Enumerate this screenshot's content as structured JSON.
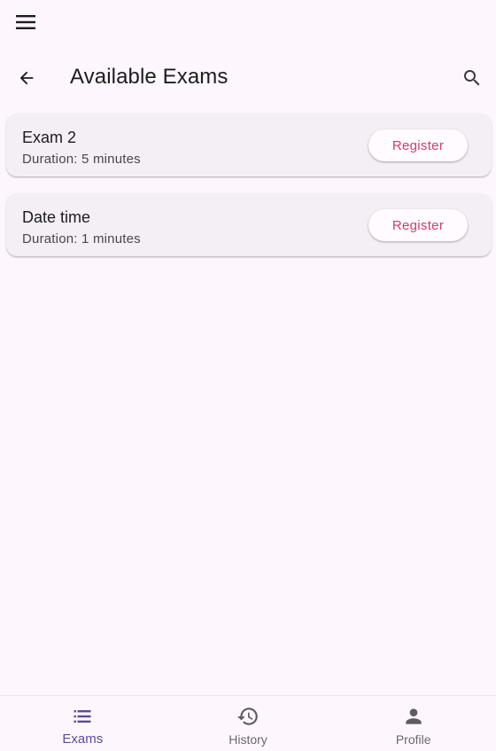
{
  "header": {
    "menu_icon": "hamburger-menu-icon",
    "back_icon": "arrow-back-icon",
    "title": "Available Exams",
    "search_icon": "search-icon"
  },
  "exams": [
    {
      "name": "Exam 2",
      "duration": "Duration: 5 minutes",
      "action_label": "Register"
    },
    {
      "name": "Date time",
      "duration": "Duration: 1 minutes",
      "action_label": "Register"
    }
  ],
  "bottom_nav": {
    "items": [
      {
        "label": "Exams",
        "icon": "list-icon",
        "active": true
      },
      {
        "label": "History",
        "icon": "history-icon",
        "active": false
      },
      {
        "label": "Profile",
        "icon": "person-icon",
        "active": false
      }
    ]
  },
  "colors": {
    "background": "#fdf7fd",
    "card": "#f4eef5",
    "accent_text": "#c7416b",
    "nav_active": "#5e4b9c",
    "nav_inactive": "#6b6770"
  }
}
